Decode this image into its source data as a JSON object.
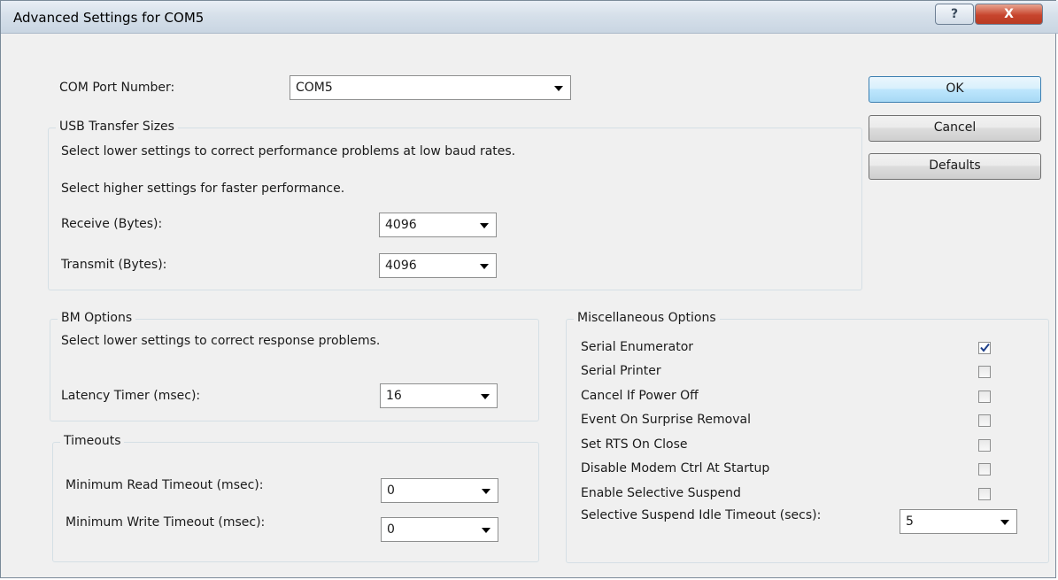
{
  "window": {
    "title": "Advanced Settings for COM5",
    "help_symbol": "?",
    "close_symbol": "X"
  },
  "com_port": {
    "label": "COM Port Number:",
    "value": "COM5"
  },
  "usb_transfer": {
    "legend": "USB Transfer Sizes",
    "hint_low": "Select lower settings to correct performance problems at low baud rates.",
    "hint_high": "Select higher settings for faster performance.",
    "receive_label": "Receive (Bytes):",
    "receive_value": "4096",
    "transmit_label": "Transmit (Bytes):",
    "transmit_value": "4096"
  },
  "bm_options": {
    "legend": "BM Options",
    "hint": "Select lower settings to correct response problems.",
    "latency_label": "Latency Timer (msec):",
    "latency_value": "16"
  },
  "timeouts": {
    "legend": "Timeouts",
    "read_label": "Minimum Read Timeout (msec):",
    "read_value": "0",
    "write_label": "Minimum Write Timeout (msec):",
    "write_value": "0"
  },
  "misc": {
    "legend": "Miscellaneous Options",
    "options": [
      {
        "label": "Serial Enumerator",
        "checked": true
      },
      {
        "label": "Serial Printer",
        "checked": false
      },
      {
        "label": "Cancel If Power Off",
        "checked": false
      },
      {
        "label": "Event On Surprise Removal",
        "checked": false
      },
      {
        "label": "Set RTS On Close",
        "checked": false
      },
      {
        "label": "Disable Modem Ctrl At Startup",
        "checked": false
      },
      {
        "label": "Enable Selective Suspend",
        "checked": false
      }
    ],
    "idle_timeout_label": "Selective Suspend Idle Timeout (secs):",
    "idle_timeout_value": "5"
  },
  "buttons": {
    "ok": "OK",
    "cancel": "Cancel",
    "defaults": "Defaults"
  }
}
